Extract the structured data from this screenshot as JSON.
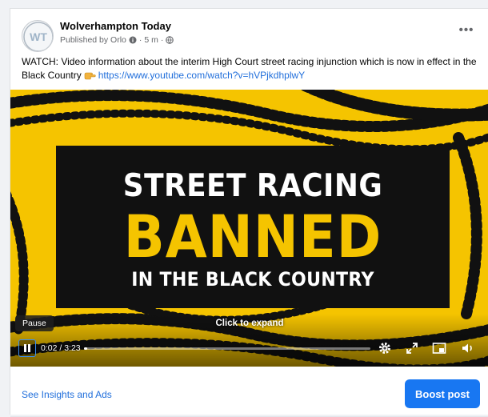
{
  "page": {
    "name": "Wolverhampton Today",
    "avatar_initials": "WT",
    "published_by": "Published by Orlo",
    "time_ago": "5 m",
    "more_label": "•••"
  },
  "post": {
    "text": "WATCH: Video information about the interim High Court street racing injunction which is now in effect in the Black Country",
    "link": "https://www.youtube.com/watch?v=hVPjkdhplwY"
  },
  "video": {
    "banner_line1": "STREET RACING",
    "banner_line2": "BANNED",
    "banner_line3": "IN THE BLACK COUNTRY",
    "tooltip": "Pause",
    "expand_hint": "Click to expand",
    "time_display": "0:02 / 3:23",
    "progress_fraction": 0.01,
    "colors": {
      "background": "#f5c400",
      "banner": "#111111",
      "accent": "#f5c400"
    }
  },
  "footer": {
    "insights_label": "See Insights and Ads",
    "boost_label": "Boost post"
  },
  "colors": {
    "link": "#216fdb",
    "primary_button": "#1877f2"
  },
  "icons": [
    "globe-icon",
    "settings-icon",
    "expand-icon",
    "miniplayer-icon",
    "volume-icon",
    "pause-icon",
    "more-options-icon"
  ]
}
